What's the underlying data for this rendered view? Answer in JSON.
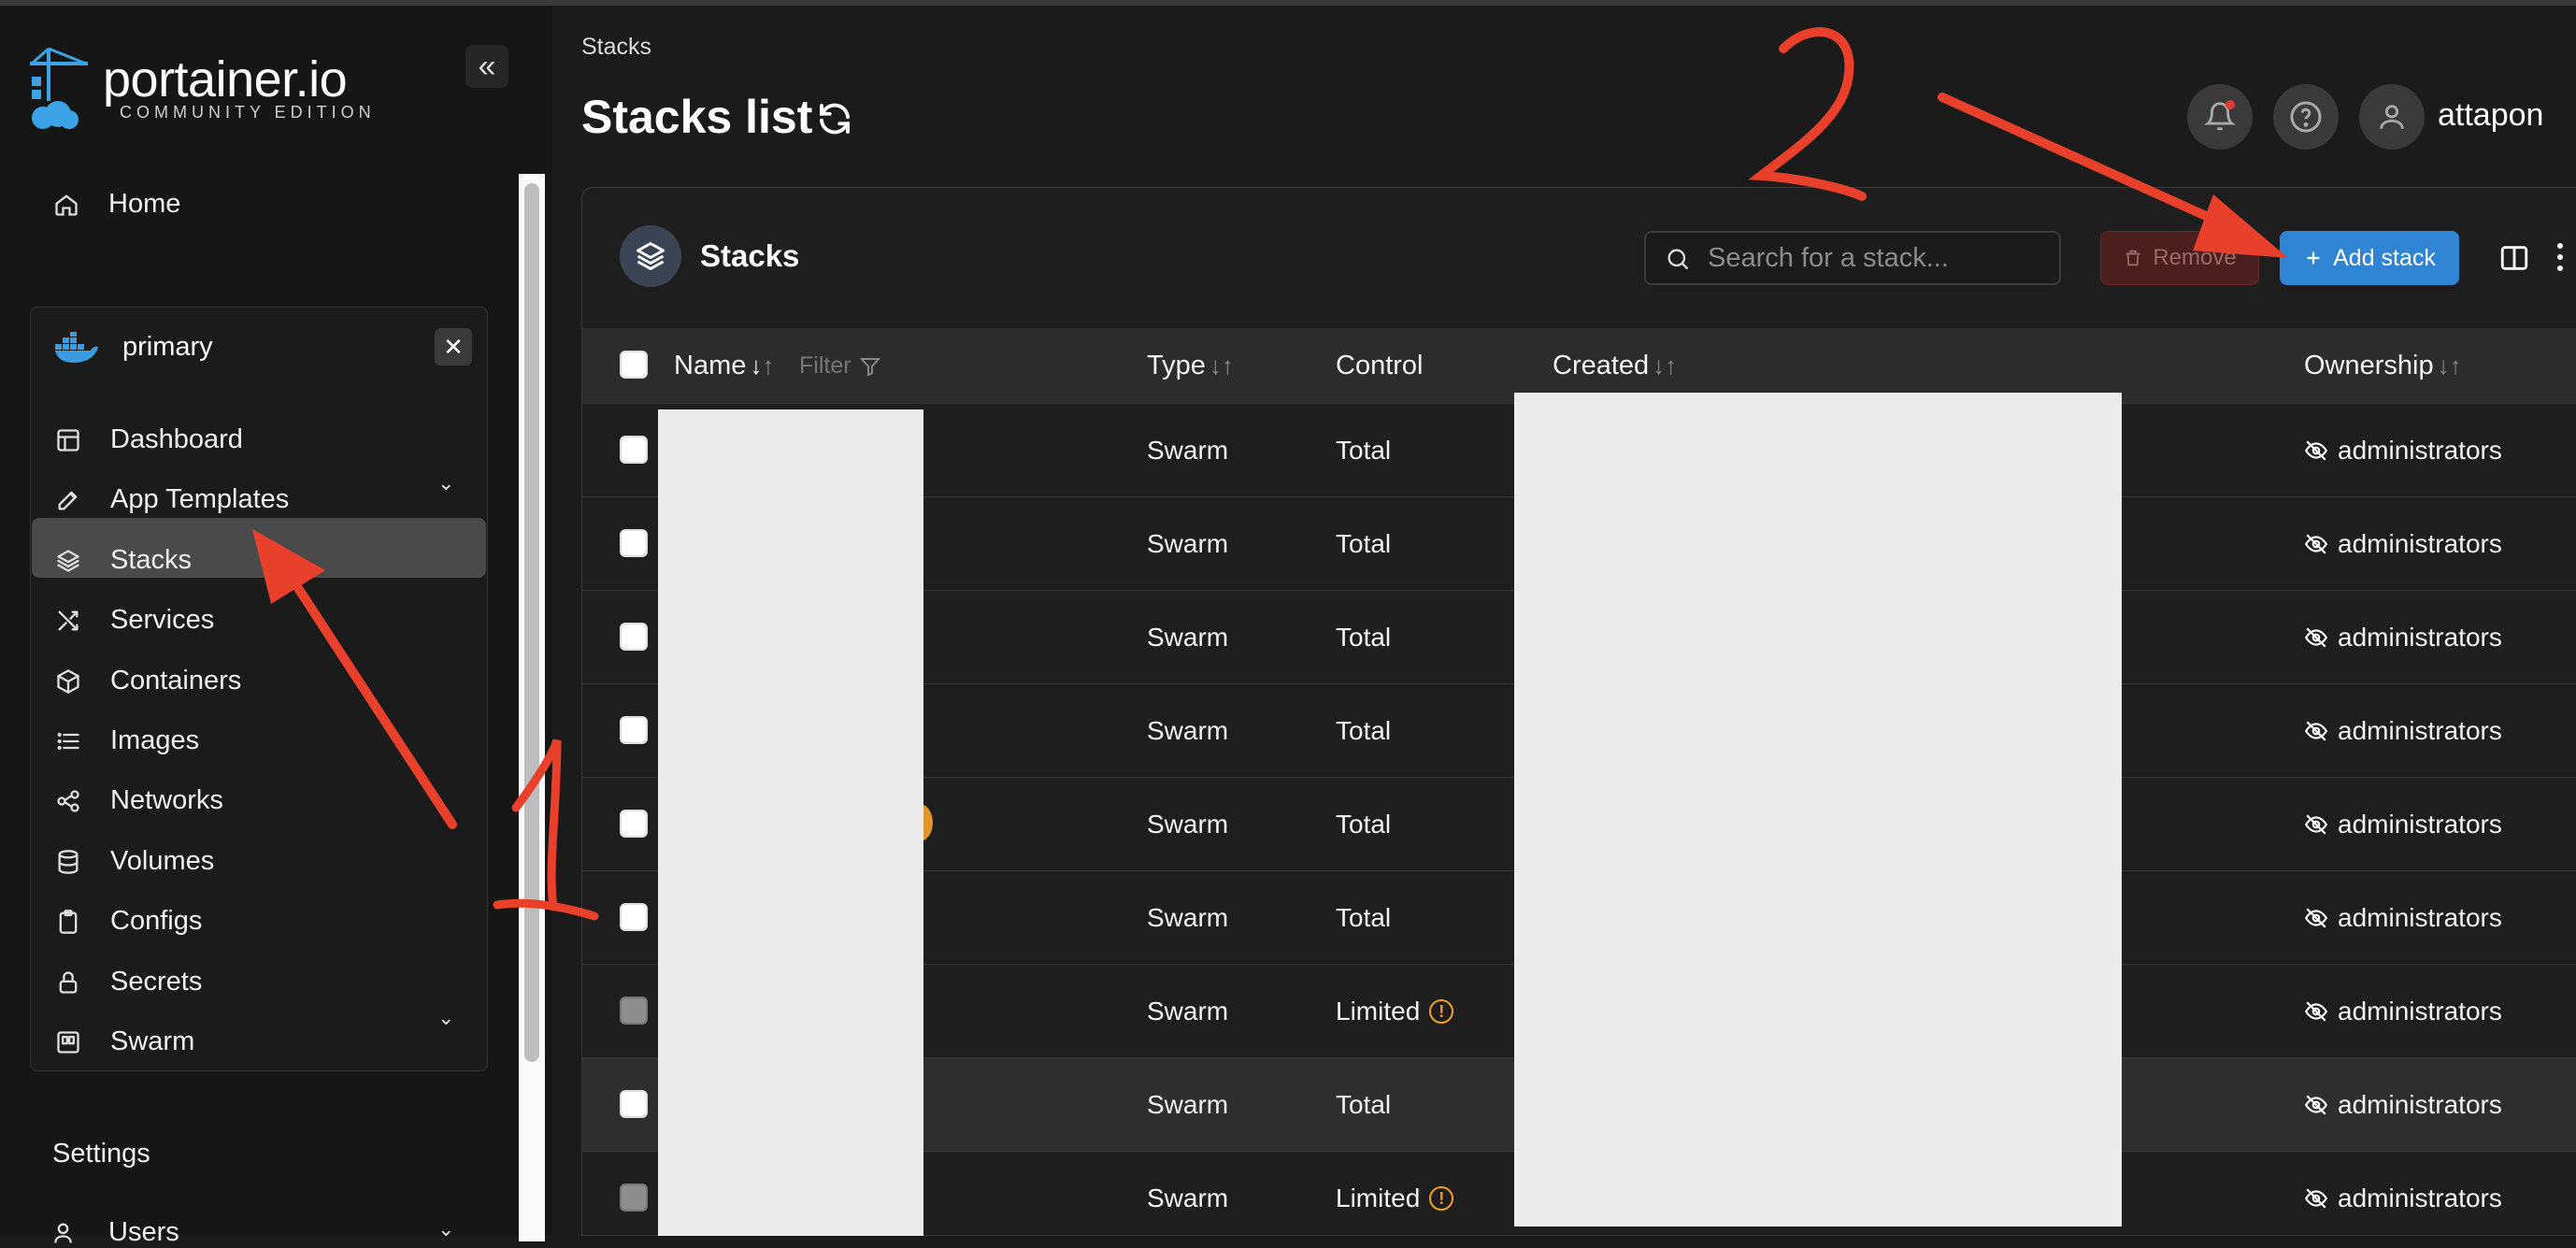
{
  "app": {
    "logo_text": "portainer.io",
    "logo_subtitle": "COMMUNITY EDITION"
  },
  "sidebar": {
    "collapse_glyph": "«",
    "home_label": "Home",
    "environment": {
      "name": "primary",
      "close_glyph": "✕",
      "items": [
        {
          "label": "Dashboard",
          "icon": "dashboard-icon"
        },
        {
          "label": "App Templates",
          "icon": "edit-icon"
        },
        {
          "label": "Stacks",
          "icon": "layers-icon"
        },
        {
          "label": "Services",
          "icon": "shuffle-icon"
        },
        {
          "label": "Containers",
          "icon": "box-icon"
        },
        {
          "label": "Images",
          "icon": "list-icon"
        },
        {
          "label": "Networks",
          "icon": "share-icon"
        },
        {
          "label": "Volumes",
          "icon": "database-icon"
        },
        {
          "label": "Configs",
          "icon": "clipboard-icon"
        },
        {
          "label": "Secrets",
          "icon": "lock-icon"
        },
        {
          "label": "Swarm",
          "icon": "swarm-icon"
        }
      ],
      "active": "Stacks"
    },
    "settings_label": "Settings",
    "users_label": "Users"
  },
  "header": {
    "breadcrumb": "Stacks",
    "title": "Stacks list",
    "username": "attapon"
  },
  "card": {
    "title": "Stacks",
    "search_placeholder": "Search for a stack...",
    "remove_label": "Remove",
    "add_label": "Add stack"
  },
  "table": {
    "columns": {
      "name": "Name",
      "filter": "Filter",
      "type": "Type",
      "control": "Control",
      "created": "Created",
      "ownership": "Ownership"
    },
    "rows": [
      {
        "type": "Swarm",
        "control": "Total",
        "warning": false,
        "ownership": "administrators"
      },
      {
        "type": "Swarm",
        "control": "Total",
        "warning": false,
        "ownership": "administrators"
      },
      {
        "type": "Swarm",
        "control": "Total",
        "warning": false,
        "ownership": "administrators"
      },
      {
        "type": "Swarm",
        "control": "Total",
        "warning": false,
        "ownership": "administrators"
      },
      {
        "type": "Swarm",
        "control": "Total",
        "warning": false,
        "ownership": "administrators"
      },
      {
        "type": "Swarm",
        "control": "Total",
        "warning": false,
        "ownership": "administrators"
      },
      {
        "type": "Swarm",
        "control": "Limited",
        "warning": true,
        "ownership": "administrators"
      },
      {
        "type": "Swarm",
        "control": "Total",
        "warning": false,
        "ownership": "administrators"
      },
      {
        "type": "Swarm",
        "control": "Limited",
        "warning": true,
        "ownership": "administrators"
      }
    ]
  },
  "annotations": {
    "color": "#e8402a",
    "marks": [
      "1",
      "2"
    ]
  }
}
